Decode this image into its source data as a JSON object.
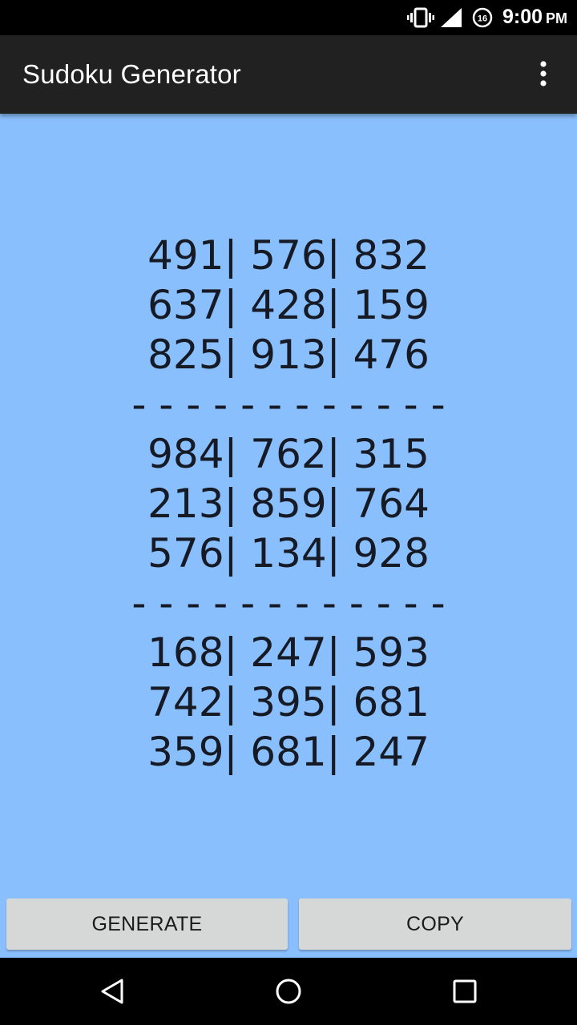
{
  "status_bar": {
    "time": "9:00",
    "ampm": "PM",
    "dnd_badge": "16",
    "icons": [
      "vibrate-icon",
      "cell-signal-icon",
      "do-not-disturb-timer-icon"
    ]
  },
  "app_bar": {
    "title": "Sudoku Generator",
    "overflow_icon": "more-vert-icon"
  },
  "sudoku": {
    "rows": [
      "491| 576| 832",
      "637| 428| 159",
      "825| 913| 476",
      "- - - - - - - - - - - -",
      "984| 762| 315",
      "213| 859| 764",
      "576| 134| 928",
      "- - - - - - - - - - - -",
      "168| 247| 593",
      "742| 395| 681",
      "359| 681| 247"
    ]
  },
  "buttons": {
    "generate": "GENERATE",
    "copy": "COPY"
  },
  "colors": {
    "background": "#8abffe",
    "app_bar": "#212121",
    "button": "#d6d7d7",
    "text": "#161a24"
  },
  "nav_bar": {
    "icons": [
      "back-icon",
      "home-icon",
      "recents-icon"
    ]
  }
}
